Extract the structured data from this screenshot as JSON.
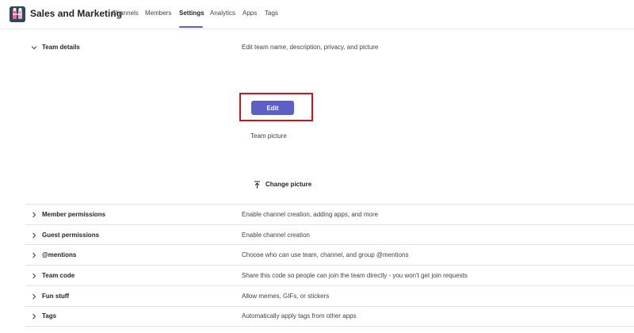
{
  "header": {
    "team_name": "Sales and Marketing",
    "tabs": [
      {
        "label": "Channels"
      },
      {
        "label": "Members"
      },
      {
        "label": "Settings",
        "active": true
      },
      {
        "label": "Analytics"
      },
      {
        "label": "Apps"
      },
      {
        "label": "Tags"
      }
    ]
  },
  "team_details": {
    "title": "Team details",
    "description": "Edit team name, description, privacy, and picture",
    "edit_label": "Edit",
    "team_picture_label": "Team picture",
    "change_picture_label": "Change picture"
  },
  "sections": [
    {
      "title": "Member permissions",
      "description": "Enable channel creation, adding apps, and more"
    },
    {
      "title": "Guest permissions",
      "description": "Enable channel creation"
    },
    {
      "title": "@mentions",
      "description": "Choose who can use team, channel, and group @mentions"
    },
    {
      "title": "Team code",
      "description": "Share this code so people can join the team directly - you won't get join requests"
    },
    {
      "title": "Fun stuff",
      "description": "Allow memes, GIFs, or stickers"
    },
    {
      "title": "Tags",
      "description": "Automatically apply tags from other apps"
    }
  ],
  "colors": {
    "accent": "#5b5fc7",
    "highlight": "#c4161c"
  }
}
